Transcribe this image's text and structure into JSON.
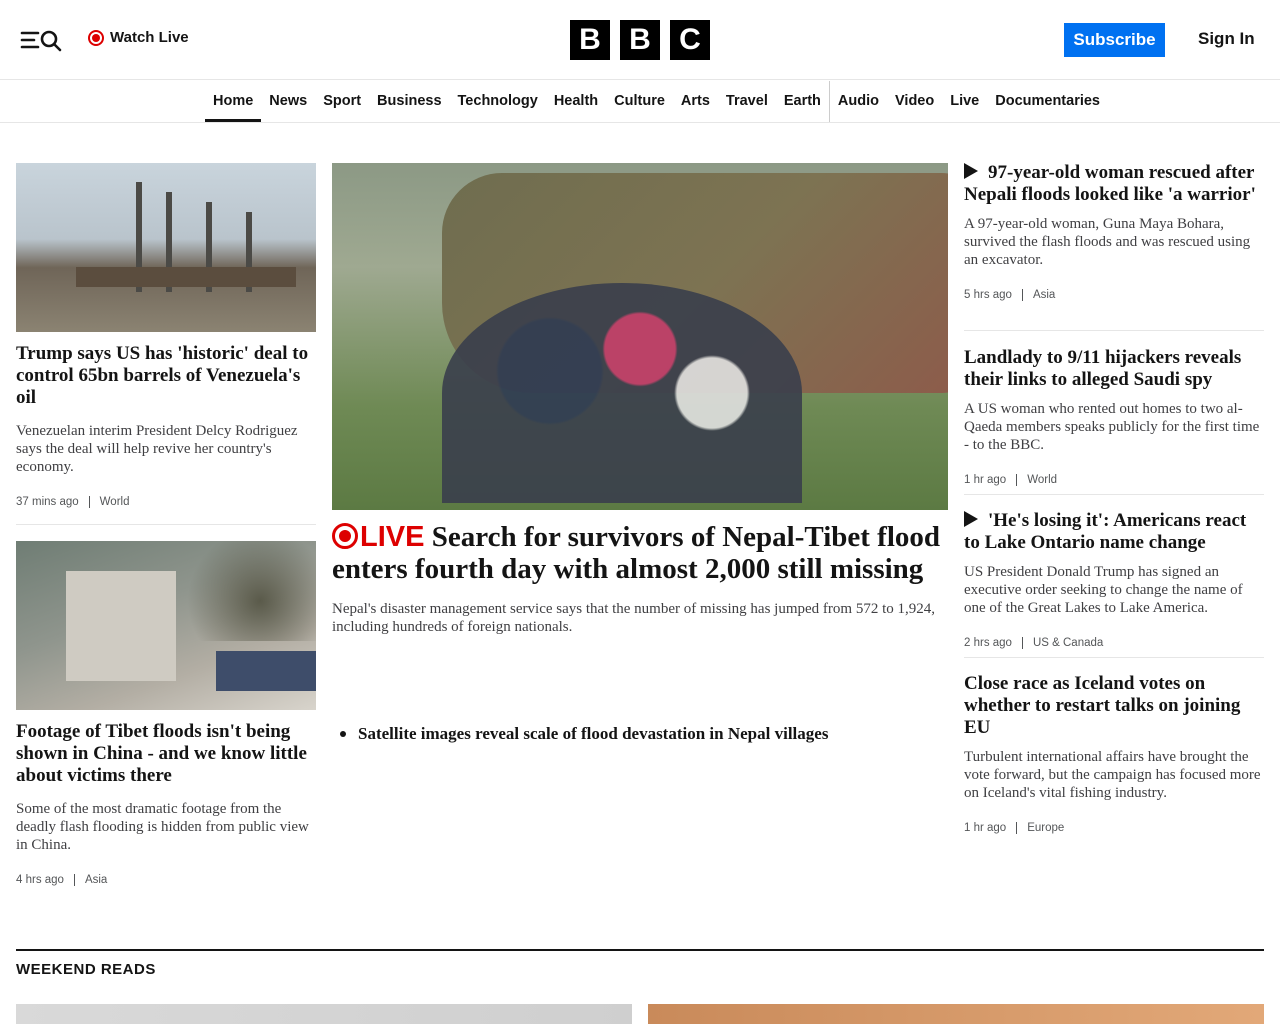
{
  "header": {
    "watch_live": "Watch Live",
    "logo_letters": [
      "B",
      "B",
      "C"
    ],
    "subscribe": "Subscribe",
    "sign_in": "Sign In"
  },
  "nav": {
    "items": [
      "Home",
      "News",
      "Sport",
      "Business",
      "Technology",
      "Health",
      "Culture",
      "Arts",
      "Travel",
      "Earth",
      "Audio",
      "Video",
      "Live",
      "Documentaries"
    ],
    "active": "Home"
  },
  "left": {
    "story1": {
      "headline": "Trump says US has 'historic' deal to control 65bn barrels of Venezuela's oil",
      "summary": "Venezuelan interim President Delcy Rodriguez says the deal will help revive her country's economy.",
      "time": "37 mins ago",
      "tag": "World"
    },
    "story2": {
      "headline": "Footage of Tibet floods isn't being shown in China - and we know little about victims there",
      "summary": "Some of the most dramatic footage from the deadly flash flooding is hidden from public view in China.",
      "time": "4 hrs ago",
      "tag": "Asia"
    }
  },
  "main": {
    "live_label": "LIVE",
    "headline": "Search for survivors of Nepal-Tibet flood enters fourth day with almost 2,000 still missing",
    "summary": "Nepal's disaster management service says that the number of missing has jumped from 572 to 1,924, including hundreds of foreign nationals.",
    "related": "Satellite images reveal scale of flood devastation in Nepal villages"
  },
  "right": {
    "story1": {
      "headline": "97-year-old woman rescued after Nepali floods looked like 'a warrior'",
      "summary": "A 97-year-old woman, Guna Maya Bohara, survived the flash floods and was rescued using an excavator.",
      "time": "5 hrs ago",
      "tag": "Asia"
    },
    "story2": {
      "headline": "Landlady to 9/11 hijackers reveals their links to alleged Saudi spy",
      "summary": "A US woman who rented out homes to two al-Qaeda members speaks publicly for the first time - to the BBC.",
      "time": "1 hr ago",
      "tag": "World"
    },
    "story3": {
      "headline": "'He's losing it': Americans react to Lake Ontario name change",
      "summary": "US President Donald Trump has signed an executive order seeking to change the name of one of the Great Lakes to Lake America.",
      "time": "2 hrs ago",
      "tag": "US & Canada"
    },
    "story4": {
      "headline": "Close race as Iceland votes on whether to restart talks on joining EU",
      "summary": "Turbulent international affairs have brought the vote forward, but the campaign has focused more on Iceland's vital fishing industry.",
      "time": "1 hr ago",
      "tag": "Europe"
    }
  },
  "section": {
    "title": "WEEKEND READS"
  },
  "colors": {
    "accent_live": "#dd0000",
    "subscribe_bg": "#0071f1",
    "text": "#141414"
  }
}
